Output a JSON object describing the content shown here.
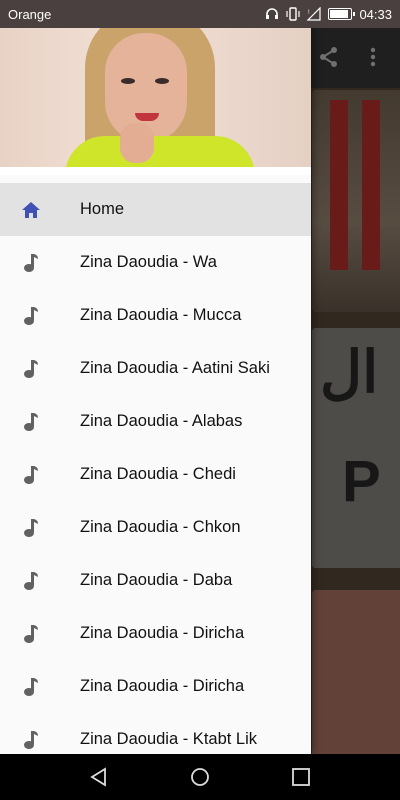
{
  "status_bar": {
    "carrier": "Orange",
    "time": "04:33",
    "battery_level": 0.9
  },
  "drawer": {
    "items": [
      {
        "label": "Home",
        "icon": "home-icon",
        "active": true
      },
      {
        "label": "Zina Daoudia - Wa",
        "icon": "music-note-icon"
      },
      {
        "label": "Zina Daoudia - Mucca",
        "icon": "music-note-icon"
      },
      {
        "label": "Zina Daoudia - Aatini Saki",
        "icon": "music-note-icon"
      },
      {
        "label": "Zina Daoudia - Alabas",
        "icon": "music-note-icon"
      },
      {
        "label": "Zina Daoudia - Chedi",
        "icon": "music-note-icon"
      },
      {
        "label": "Zina Daoudia - Chkon",
        "icon": "music-note-icon"
      },
      {
        "label": "Zina Daoudia - Daba",
        "icon": "music-note-icon"
      },
      {
        "label": "Zina Daoudia - Diricha",
        "icon": "music-note-icon"
      },
      {
        "label": "Zina Daoudia - Diricha",
        "icon": "music-note-icon"
      },
      {
        "label": "Zina Daoudia - Ktabt Lik",
        "icon": "music-note-icon"
      }
    ]
  },
  "colors": {
    "home_icon": "#3f51b5",
    "note_icon": "#616161",
    "active_bg": "#e2e2e2"
  }
}
